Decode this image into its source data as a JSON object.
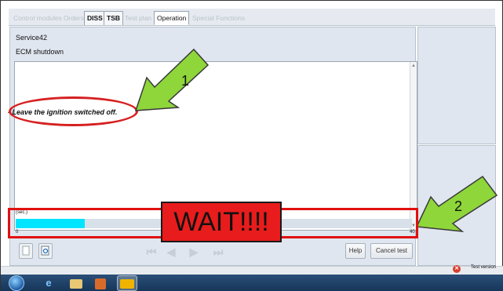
{
  "tabs": [
    {
      "label": "Control modules",
      "style": "disabled"
    },
    {
      "label": "Orders",
      "style": "disabled"
    },
    {
      "label": "DISS",
      "style": "bold"
    },
    {
      "label": "TSB",
      "style": "bold"
    },
    {
      "label": "Test plan",
      "style": "disabled"
    },
    {
      "label": "Operation",
      "style": "active"
    },
    {
      "label": "Special Functions",
      "style": "disabled"
    }
  ],
  "panel": {
    "header_line1": "Service42",
    "header_line2": "ECM shutdown",
    "instruction": "- Leave the ignition switched off."
  },
  "progress": {
    "label": "(sec.)",
    "min_label": "0",
    "max_label": "40",
    "min": 0,
    "max": 40,
    "value": 7
  },
  "toolbar": {
    "help_label": "Help",
    "cancel_label": "Cancel test"
  },
  "status": {
    "test_version": "Test version"
  },
  "annotations": {
    "wait_text": "WAIT!!!!",
    "arrow1_label": "1",
    "arrow2_label": "2"
  },
  "colors": {
    "progress_fill": "#00e5ff",
    "annotation_red": "#e01010",
    "arrow_green": "#8ed63a"
  }
}
